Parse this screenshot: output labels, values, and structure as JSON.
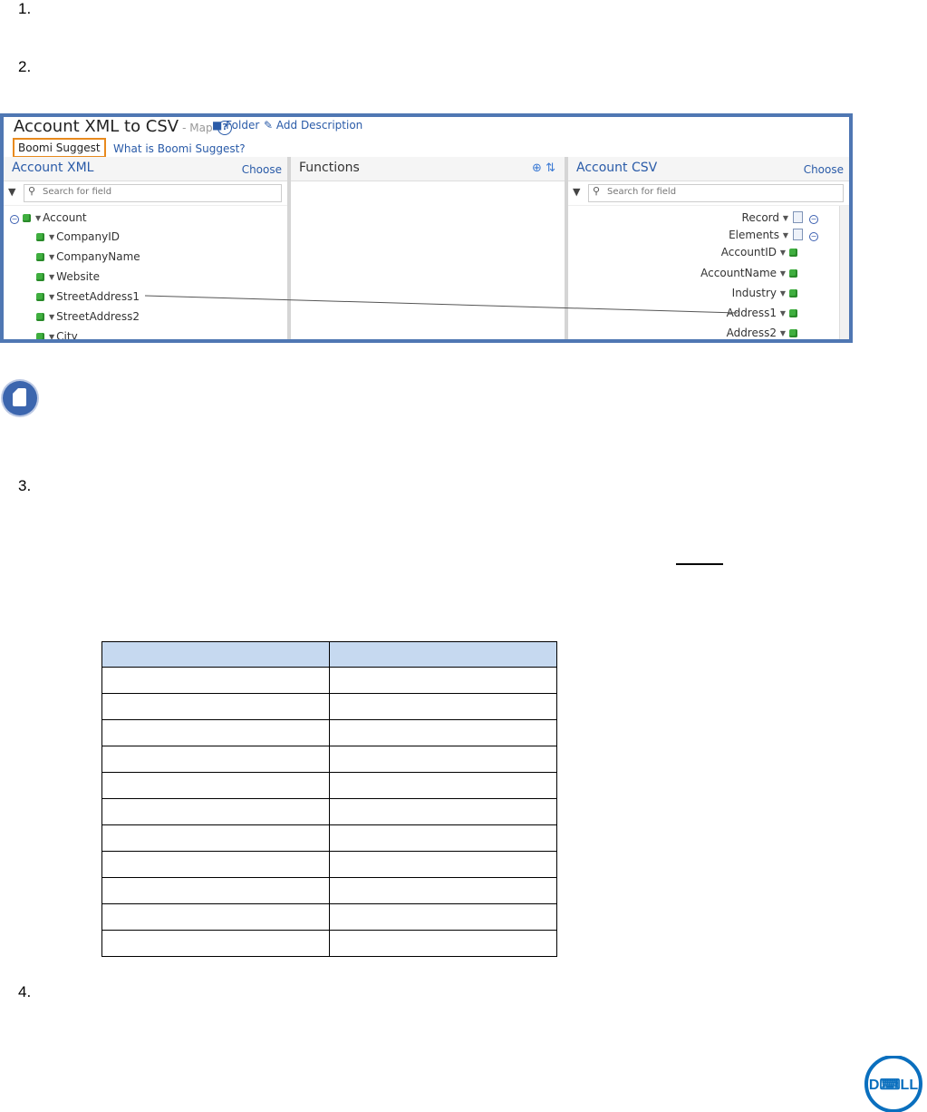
{
  "steps": [
    "1.",
    "2.",
    "3.",
    "4."
  ],
  "map_window": {
    "title": "Account XML to CSV",
    "subtitle": "- Map",
    "help_icon": "question-circle-icon",
    "folder_link": "Folder",
    "add_description_link": "Add Description",
    "boomi_suggest_button": "Boomi Suggest",
    "what_is_link": "What is Boomi Suggest?"
  },
  "left_panel": {
    "title": "Account XML",
    "choose": "Choose",
    "search_placeholder": "Search for field",
    "nodes": [
      "Account",
      "CompanyID",
      "CompanyName",
      "Website",
      "StreetAddress1",
      "StreetAddress2",
      "City"
    ]
  },
  "middle_panel": {
    "title": "Functions"
  },
  "right_panel": {
    "title": "Account CSV",
    "choose": "Choose",
    "search_placeholder": "Search for field",
    "nodes": [
      "Record",
      "Elements",
      "AccountID",
      "AccountName",
      "Industry",
      "Address1",
      "Address2"
    ]
  },
  "mapping": {
    "from": "StreetAddress1",
    "to": "Address1"
  },
  "table": {
    "rows": 11,
    "columns": 2
  },
  "colors": {
    "frame": "#4f77b3",
    "highlight": "#e88a1e",
    "link": "#2a5ba8",
    "table_header": "#c6d9f0"
  },
  "icons": [
    "note-icon",
    "dell-logo"
  ]
}
